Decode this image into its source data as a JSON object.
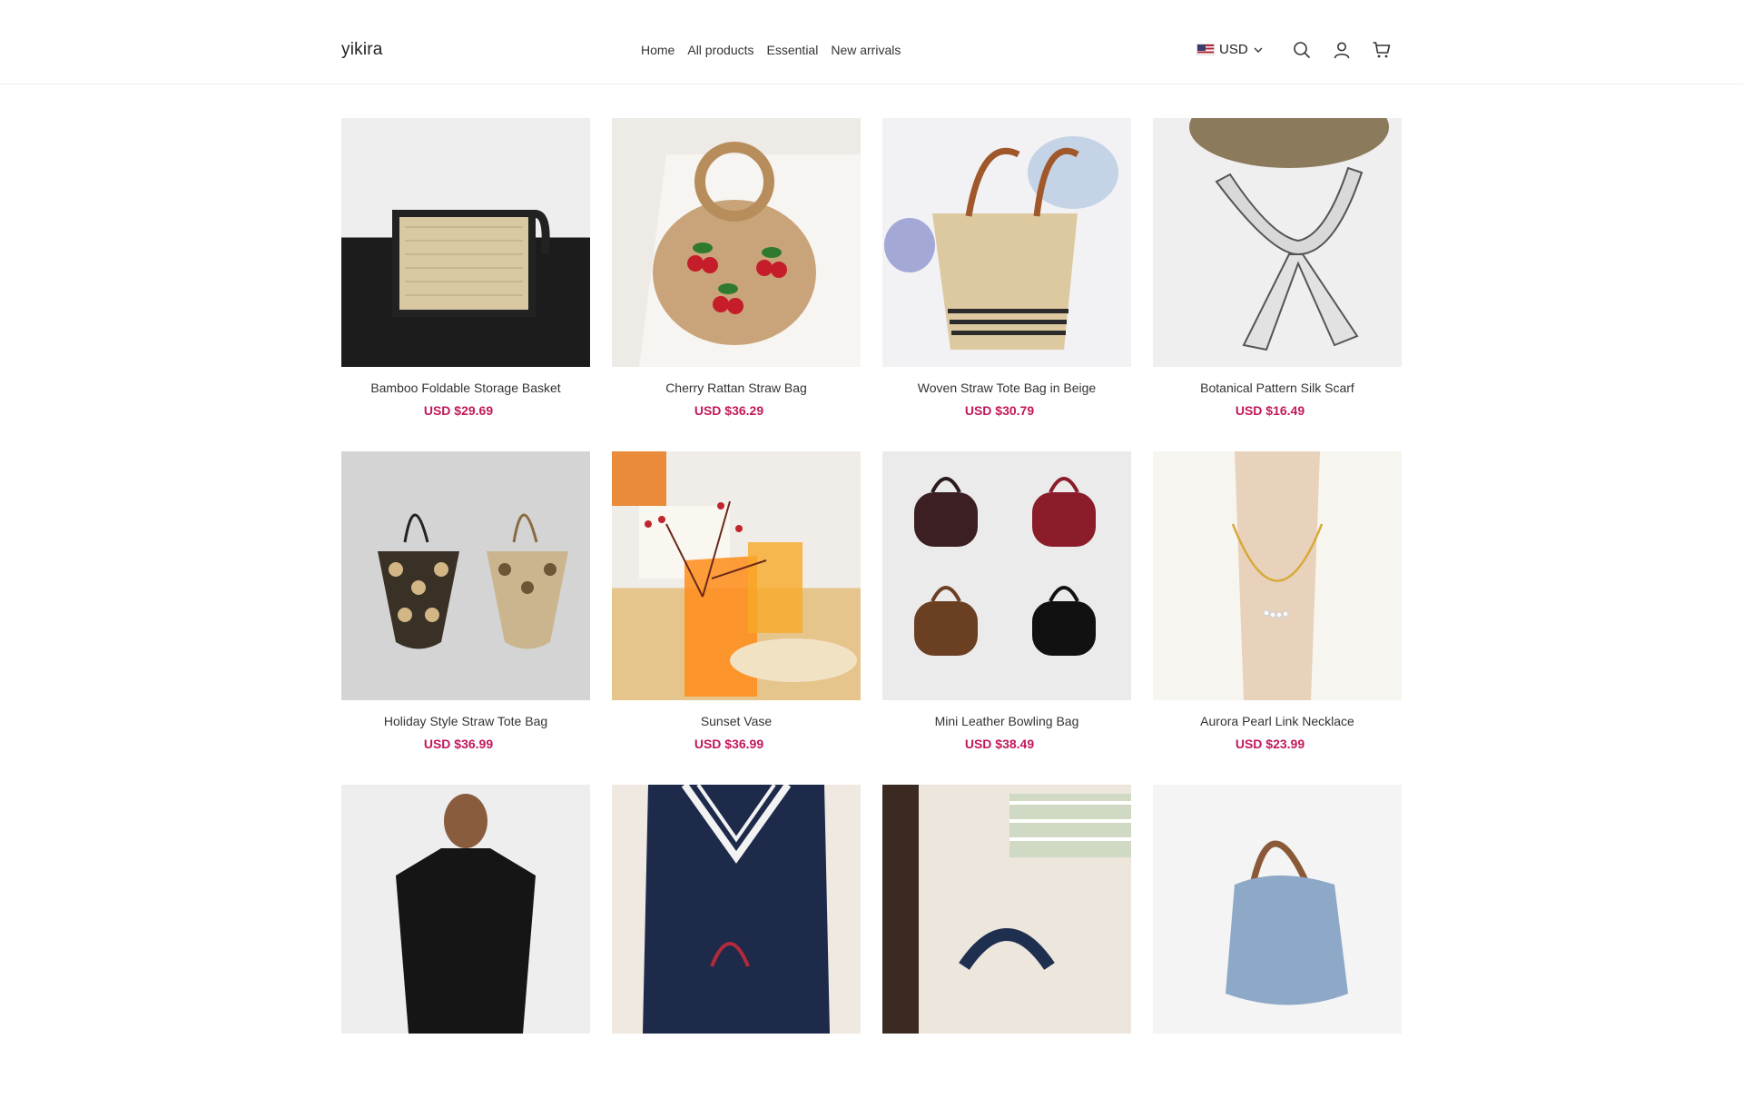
{
  "header": {
    "logo": "yikira",
    "nav": [
      "Home",
      "All products",
      "Essential",
      "New arrivals"
    ],
    "currency": "USD"
  },
  "icons": {
    "search": "search-icon",
    "account": "user-icon",
    "cart": "cart-icon",
    "flag": "us-flag-icon"
  },
  "colors": {
    "price": "#c2185b",
    "text": "#333333"
  },
  "products": [
    {
      "name": "Bamboo Foldable Storage Basket",
      "price": "USD $29.69"
    },
    {
      "name": "Cherry Rattan Straw Bag",
      "price": "USD $36.29"
    },
    {
      "name": "Woven Straw Tote Bag in Beige",
      "price": "USD $30.79"
    },
    {
      "name": "Botanical Pattern Silk Scarf",
      "price": "USD $16.49"
    },
    {
      "name": "Holiday Style Straw Tote Bag",
      "price": "USD $36.99"
    },
    {
      "name": "Sunset Vase",
      "price": "USD $36.99"
    },
    {
      "name": "Mini Leather Bowling Bag",
      "price": "USD $38.49"
    },
    {
      "name": "Aurora Pearl Link Necklace",
      "price": "USD $23.99"
    },
    {
      "name": "",
      "price": ""
    },
    {
      "name": "",
      "price": ""
    },
    {
      "name": "",
      "price": ""
    },
    {
      "name": "",
      "price": ""
    }
  ]
}
